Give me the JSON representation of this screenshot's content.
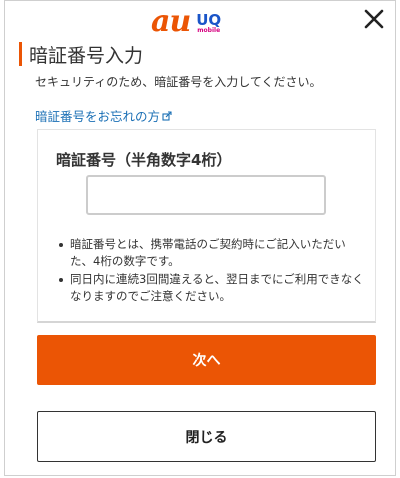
{
  "header": {
    "logo_main": "au",
    "logo_secondary": "UQ",
    "logo_secondary_sub": "mobile",
    "close_icon": "close-icon",
    "colors": {
      "au": "#eb5505",
      "uq": "#1a55c8",
      "uq_sub": "#d6007f"
    }
  },
  "page": {
    "title": "暗証番号入力",
    "description": "セキュリティのため、暗証番号を入力してください。",
    "forgot_link": "暗証番号をお忘れの方",
    "forgot_link_icon": "external-link-icon"
  },
  "form": {
    "label": "暗証番号（半角数字4桁）",
    "pin_value": "",
    "pin_placeholder": "",
    "notes": [
      "暗証番号とは、携帯電話のご契約時にご記入いただいた、4桁の数字です。",
      "同日内に連続3回間違えると、翌日までにご利用できなくなりますのでご注意ください。"
    ]
  },
  "buttons": {
    "next_label": "次へ",
    "close_label": "閉じる"
  },
  "colors": {
    "accent": "#eb5505",
    "link": "#1a6fb5"
  }
}
